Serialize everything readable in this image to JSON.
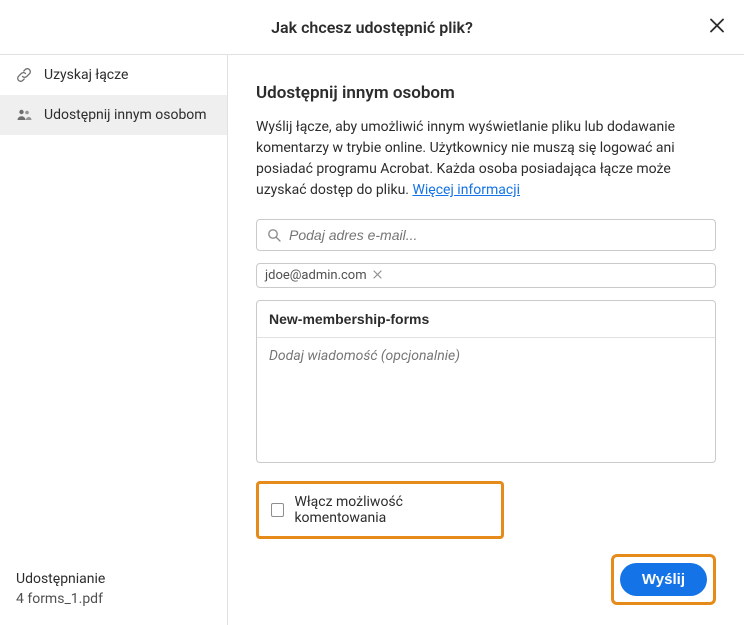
{
  "header": {
    "title": "Jak chcesz udostępnić plik?"
  },
  "sidebar": {
    "items": [
      {
        "label": "Uzyskaj łącze"
      },
      {
        "label": "Udostępnij innym osobom"
      }
    ],
    "footer": {
      "line1": "Udostępnianie",
      "line2": "4 forms_1.pdf"
    }
  },
  "main": {
    "heading": "Udostępnij innym osobom",
    "description": "Wyślij łącze, aby umożliwić innym wyświetlanie pliku lub dodawanie komentarzy w trybie online. Użytkownicy nie muszą się logować ani posiadać programu Acrobat. Każda osoba posiadająca łącze może uzyskać dostęp do pliku. ",
    "more_link": "Więcej informacji",
    "email_placeholder": "Podaj adres e-mail...",
    "chip_email": "jdoe@admin.com",
    "subject_value": "New-membership-forms",
    "message_placeholder": "Dodaj wiadomość (opcjonalnie)",
    "checkbox_label": "Włącz możliwość komentowania",
    "send_label": "Wyślij"
  }
}
